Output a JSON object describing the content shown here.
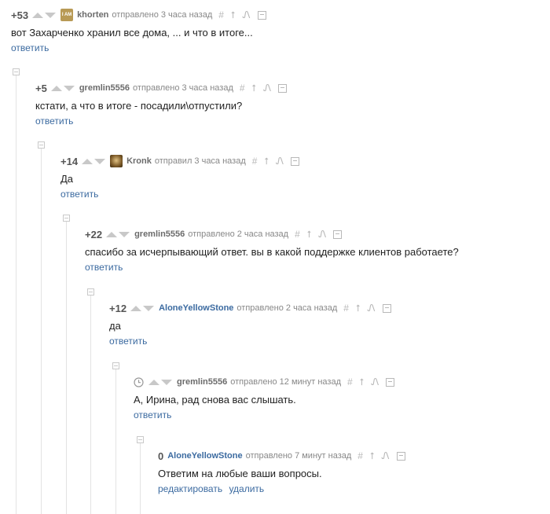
{
  "comments": [
    {
      "rating": "+53",
      "author": "khorten",
      "avatar_text": "I AM",
      "posted": "отправлено 3 часа назад",
      "text": "вот Захарченко хранил все дома, ... и что в итоге...",
      "actions": [
        "ответить"
      ]
    },
    {
      "rating": "+5",
      "author": "gremlin5556",
      "posted": "отправлено 3 часа назад",
      "text": "кстати, а что в итоге - посадили\\отпустили?",
      "actions": [
        "ответить"
      ]
    },
    {
      "rating": "+14",
      "author": "Kronk",
      "posted": "отправил 3 часа назад",
      "text": "Да",
      "actions": [
        "ответить"
      ]
    },
    {
      "rating": "+22",
      "author": "gremlin5556",
      "posted": "отправлено 2 часа назад",
      "text": "спасибо за исчерпывающий ответ. вы в какой поддержке клиентов работаете?",
      "actions": [
        "ответить"
      ]
    },
    {
      "rating": "+12",
      "author": "AloneYellowStone",
      "posted": "отправлено 2 часа назад",
      "text": "да",
      "actions": [
        "ответить"
      ]
    },
    {
      "rating": "",
      "author": "gremlin5556",
      "posted": "отправлено 12 минут назад",
      "text": "А, Ирина, рад снова вас слышать.",
      "actions": [
        "ответить"
      ]
    },
    {
      "rating": "0",
      "author": "AloneYellowStone",
      "posted": "отправлено 7 минут назад",
      "text": "Ответим на любые ваши вопросы.",
      "actions": [
        "редактировать",
        "удалить"
      ]
    }
  ],
  "tool_icons": {
    "hash": "#",
    "parent": "⭡",
    "branch": "Ꮑ"
  },
  "colors": {
    "link": "#3b6aa0",
    "author_highlight": "#3b6aa0",
    "text": "#222222",
    "meta": "#888888",
    "icon": "#b8b8b8"
  }
}
